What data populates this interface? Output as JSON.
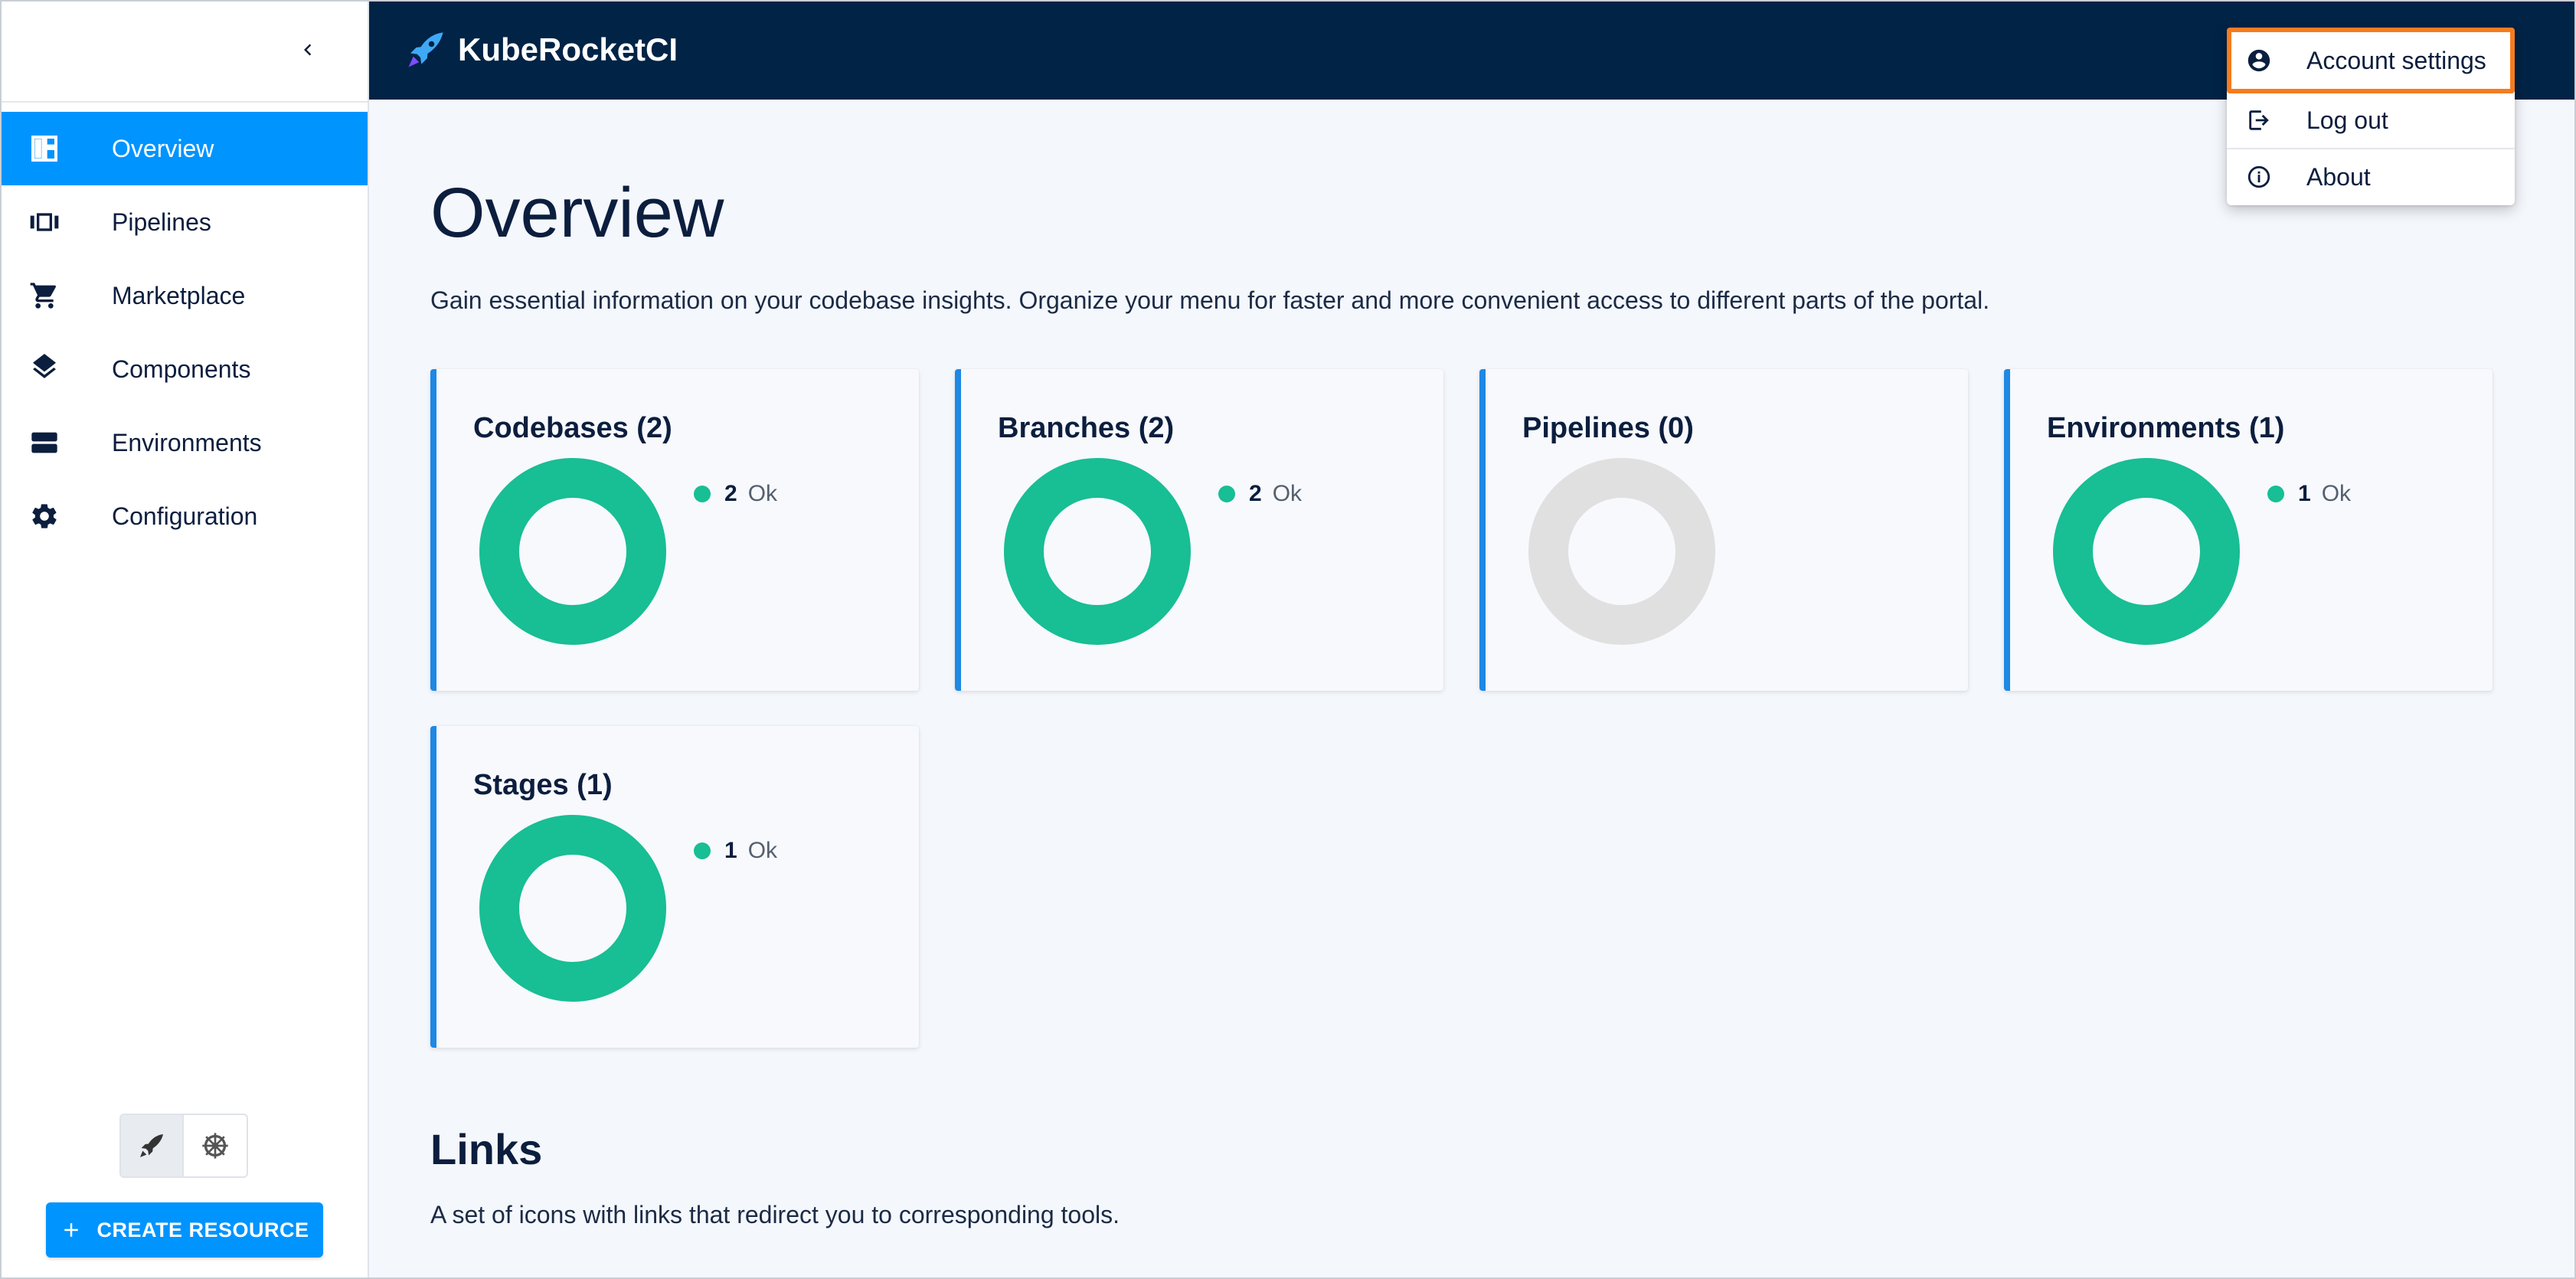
{
  "app": {
    "brand": "KubeRocketCI"
  },
  "sidebar": {
    "items": [
      {
        "label": "Overview",
        "icon": "dashboard-icon",
        "active": true
      },
      {
        "label": "Pipelines",
        "icon": "pipelines-icon",
        "active": false
      },
      {
        "label": "Marketplace",
        "icon": "cart-icon",
        "active": false
      },
      {
        "label": "Components",
        "icon": "layers-icon",
        "active": false
      },
      {
        "label": "Environments",
        "icon": "storage-icon",
        "active": false
      },
      {
        "label": "Configuration",
        "icon": "gear-icon",
        "active": false
      }
    ],
    "create_button": "CREATE RESOURCE",
    "mode_toggle": [
      "rocket-icon",
      "helm-icon"
    ]
  },
  "main": {
    "title": "Overview",
    "description": "Gain essential information on your codebase insights. Organize your menu for faster and more convenient access to different parts of the portal.",
    "cards": [
      {
        "title": "Codebases (2)",
        "count": "2",
        "status": "Ok",
        "empty": false
      },
      {
        "title": "Branches (2)",
        "count": "2",
        "status": "Ok",
        "empty": false
      },
      {
        "title": "Pipelines (0)",
        "count": "",
        "status": "",
        "empty": true
      },
      {
        "title": "Environments (1)",
        "count": "1",
        "status": "Ok",
        "empty": false
      },
      {
        "title": "Stages (1)",
        "count": "1",
        "status": "Ok",
        "empty": false
      }
    ],
    "links_title": "Links",
    "links_description": "A set of icons with links that redirect you to corresponding tools."
  },
  "user_menu": {
    "items": [
      {
        "label": "Account settings",
        "icon": "account-circle-icon"
      },
      {
        "label": "Log out",
        "icon": "logout-icon"
      },
      {
        "label": "About",
        "icon": "info-icon"
      }
    ]
  },
  "colors": {
    "primary": "#0094ff",
    "header_bg": "#002346",
    "ok_green": "#18be94",
    "empty_gray": "#e0e0e0",
    "card_accent": "#1e88e5",
    "highlight": "#f47c20"
  }
}
